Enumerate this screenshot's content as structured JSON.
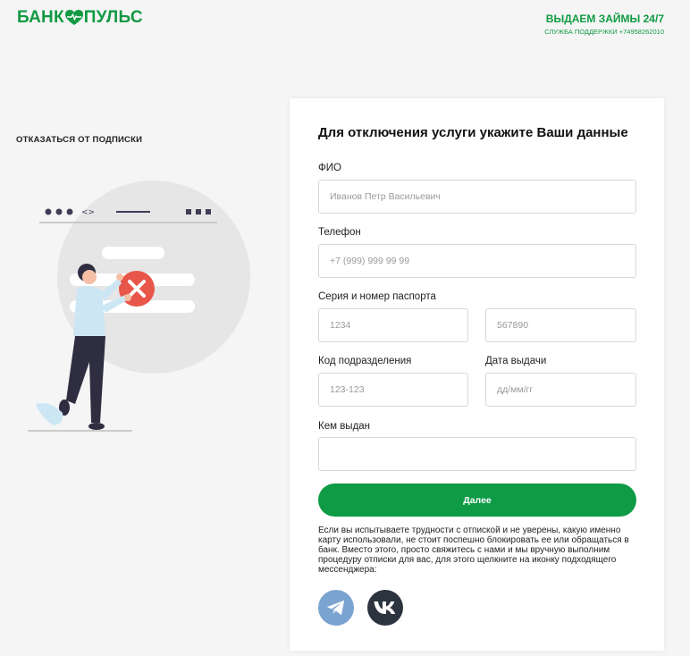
{
  "header": {
    "logo_part1": "БАНК",
    "logo_part2": "ПУЛЬС",
    "promo": "ВЫДАЕМ ЗАЙМЫ 24/7",
    "support": "СЛУЖБА ПОДДЕРЖКИ +74958262010"
  },
  "sidebar": {
    "unsubscribe_link": "ОТКАЗАТЬСЯ ОТ ПОДПИСКИ"
  },
  "form": {
    "title": "Для отключения услуги укажите Ваши данные",
    "fio": {
      "label": "ФИО",
      "placeholder": "Иванов Петр Васильевич"
    },
    "phone": {
      "label": "Телефон",
      "placeholder": "+7 (999) 999 99 99"
    },
    "passport": {
      "label": "Серия и номер паспорта",
      "series_placeholder": "1234",
      "number_placeholder": "567890"
    },
    "division": {
      "label": "Код подразделения",
      "placeholder": "123-123"
    },
    "issue_date": {
      "label": "Дата выдачи",
      "placeholder": "дд/мм/гг"
    },
    "issued_by": {
      "label": "Кем выдан",
      "placeholder": ""
    },
    "submit_label": "Далее",
    "notice": "Если вы испытываете трудности с отпиской и не уверены, какую именно карту использовали, не стоит поспешно блокировать ее или обращаться в банк. Вместо этого, просто свяжитесь с нами и мы вручную выполним процедуру отписки для вас, для этого щелкните на иконку подходящего мессенджера:"
  },
  "messengers": [
    {
      "name": "telegram-icon"
    },
    {
      "name": "vk-icon"
    }
  ],
  "colors": {
    "brand": "#119a43",
    "button": "#0f9a46",
    "telegram": "#7aa3d0",
    "vk": "#2c3440",
    "error": "#e8564a",
    "illustration_circle": "#e6e6e6"
  }
}
